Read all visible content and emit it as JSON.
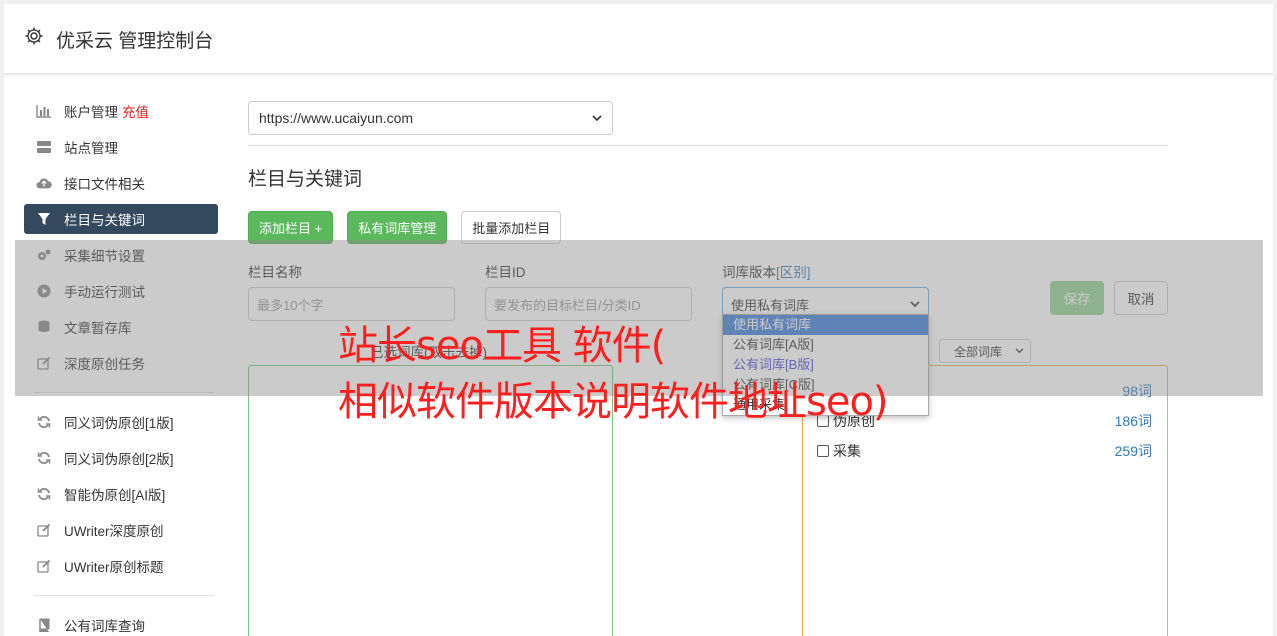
{
  "header": {
    "title": "优采云 管理控制台"
  },
  "sidebar": {
    "items": [
      {
        "label": "账户管理",
        "badge": "充值",
        "icon": "bar-chart-icon"
      },
      {
        "label": "站点管理",
        "icon": "server-icon"
      },
      {
        "label": "接口文件相关",
        "icon": "cloud-upload-icon"
      },
      {
        "label": "栏目与关键词",
        "icon": "filter-icon",
        "active": true
      },
      {
        "label": "采集细节设置",
        "icon": "gears-icon"
      },
      {
        "label": "手动运行测试",
        "icon": "play-circle-icon"
      },
      {
        "label": "文章暂存库",
        "icon": "database-icon"
      },
      {
        "label": "深度原创任务",
        "icon": "edit-icon"
      },
      {
        "label": "同义词伪原创[1版]",
        "icon": "refresh-icon"
      },
      {
        "label": "同义词伪原创[2版]",
        "icon": "refresh-icon"
      },
      {
        "label": "智能伪原创[AI版]",
        "icon": "refresh-icon"
      },
      {
        "label": "UWriter深度原创",
        "icon": "edit-icon"
      },
      {
        "label": "UWriter原创标题",
        "icon": "edit-icon"
      },
      {
        "label": "公有词库查询",
        "icon": "book-icon"
      }
    ]
  },
  "site_select": {
    "value": "https://www.ucaiyun.com"
  },
  "section": {
    "title": "栏目与关键词"
  },
  "toolbar": {
    "add_column": "添加栏目 +",
    "private_lib": "私有词库管理",
    "batch_add": "批量添加栏目"
  },
  "form": {
    "name_label": "栏目名称",
    "name_placeholder": "最多10个字",
    "id_label": "栏目ID",
    "id_placeholder": "要发布的目标栏目/分类ID",
    "version_label": "词库版本",
    "version_link": "[区别]",
    "version_value": "使用私有词库",
    "save": "保存",
    "cancel": "取消"
  },
  "dropdown": {
    "options": [
      "使用私有词库",
      "公有词库[A版]",
      "公有词库[B版]",
      "公有词库[C版]",
      "通用采集"
    ]
  },
  "left_box": {
    "header": "已选词库(双击去掉)"
  },
  "right_box": {
    "filter": "全部词库",
    "rows": [
      {
        "label": "",
        "count": "98词"
      },
      {
        "label": "伪原创",
        "count": "186词"
      },
      {
        "label": "采集",
        "count": "259词"
      }
    ]
  },
  "watermark": {
    "line1": "站长seo工具 软件(",
    "line2": "相似软件版本说明软件地址seo)"
  },
  "colors": {
    "active_nav": "#34495e",
    "green": "#5cb85c",
    "charge": "#e02020",
    "watermark": "#ff1f1f"
  }
}
